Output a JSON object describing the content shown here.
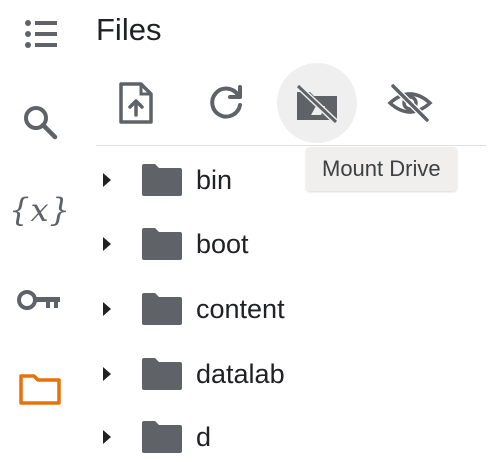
{
  "panel": {
    "title": "Files"
  },
  "rail": {
    "icons": [
      "menu-list-icon",
      "search-icon",
      "variables-icon",
      "key-icon",
      "folder-icon"
    ],
    "variables_glyph": "{x}",
    "active": "folder-icon",
    "active_color": "#e8710a"
  },
  "toolbar": {
    "buttons": [
      "upload-icon",
      "refresh-icon",
      "mount-drive-icon",
      "hide-files-icon"
    ],
    "tooltip": "Mount Drive"
  },
  "files": [
    {
      "name": "bin",
      "icon": "folder-icon"
    },
    {
      "name": "boot",
      "icon": "folder-icon"
    },
    {
      "name": "content",
      "icon": "folder-icon"
    },
    {
      "name": "datalab",
      "icon": "folder-icon"
    },
    {
      "name": "d",
      "icon": "folder-icon"
    }
  ],
  "colors": {
    "icon": "#5f6368",
    "folder": "#5f6368",
    "text": "#202124",
    "accent": "#e8710a"
  }
}
